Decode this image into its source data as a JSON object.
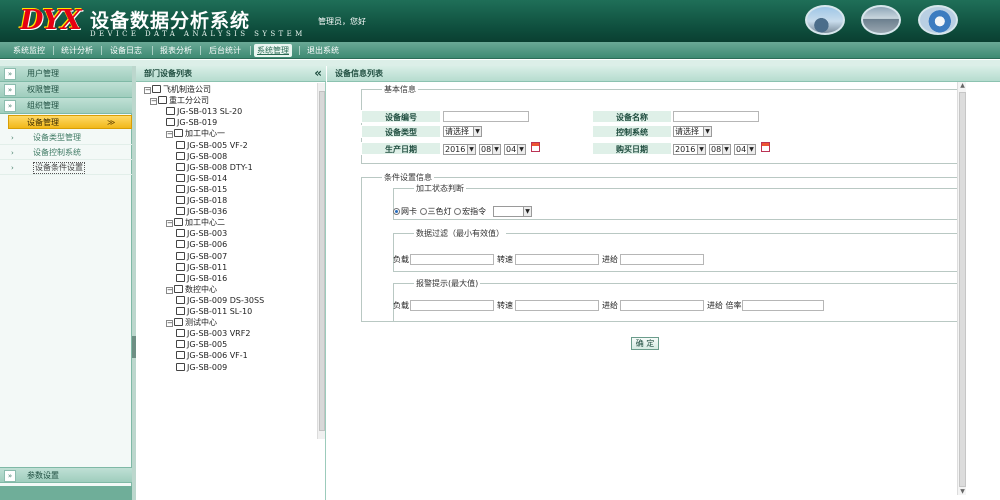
{
  "header": {
    "logo": "DYX",
    "title": "设备数据分析系统",
    "subtitle": "DEVICE DATA ANALYSIS SYSTEM",
    "greeting": "管理员，您好"
  },
  "nav": [
    "系统监控",
    "统计分析",
    "设备日志",
    "报表分析",
    "后台统计",
    "系统管理",
    "退出系统"
  ],
  "nav_active": "系统管理",
  "sidebar": {
    "arrows": "»",
    "sections": [
      "用户管理",
      "权限管理",
      "组织管理"
    ],
    "active_section": "设备管理",
    "active_chevron": "≫",
    "sub_items": [
      "设备类型管理",
      "设备控制系统",
      "设备条件设置"
    ],
    "settings": "参数设置"
  },
  "tree": {
    "title": "部门设备列表",
    "collapse": "«",
    "nodes": [
      {
        "label": "飞机制造公司",
        "level": 0
      },
      {
        "label": "重工分公司",
        "level": 1
      },
      {
        "label": "JG-SB-013 SL-20",
        "level": 2
      },
      {
        "label": "JG-SB-019",
        "level": 2
      },
      {
        "label": "加工中心一",
        "level": 2,
        "group": true
      },
      {
        "label": "JG-SB-005 VF-2",
        "level": 3
      },
      {
        "label": "JG-SB-008",
        "level": 3
      },
      {
        "label": "JG-SB-008 DTY-1",
        "level": 3
      },
      {
        "label": "JG-SB-014",
        "level": 3
      },
      {
        "label": "JG-SB-015",
        "level": 3
      },
      {
        "label": "JG-SB-018",
        "level": 3
      },
      {
        "label": "JG-SB-036",
        "level": 3
      },
      {
        "label": "加工中心二",
        "level": 2,
        "group": true
      },
      {
        "label": "JG-SB-003",
        "level": 3
      },
      {
        "label": "JG-SB-006",
        "level": 3
      },
      {
        "label": "JG-SB-007",
        "level": 3
      },
      {
        "label": "JG-SB-011",
        "level": 3
      },
      {
        "label": "JG-SB-016",
        "level": 3
      },
      {
        "label": "数控中心",
        "level": 2,
        "group": true
      },
      {
        "label": "JG-SB-009 DS-30SS",
        "level": 3
      },
      {
        "label": "JG-SB-011 SL-10",
        "level": 3
      },
      {
        "label": "测试中心",
        "level": 2,
        "group": true
      },
      {
        "label": "JG-SB-003 VRF2",
        "level": 3
      },
      {
        "label": "JG-SB-005",
        "level": 3
      },
      {
        "label": "JG-SB-006 VF-1",
        "level": 3
      },
      {
        "label": "JG-SB-009",
        "level": 3
      }
    ]
  },
  "main": {
    "title": "设备信息列表",
    "basic": {
      "legend": "基本信息",
      "device_code": "设备编号",
      "device_name": "设备名称",
      "device_type": "设备类型",
      "control_system": "控制系统",
      "placeholder_select": "请选择",
      "production_date": "生产日期",
      "purchase_date": "购买日期",
      "date_year": "2016",
      "date_month": "08",
      "date_day": "04"
    },
    "conditions": {
      "legend": "条件设置信息",
      "status_legend": "加工状态判断",
      "radios": [
        "网卡",
        "三色灯",
        "宏指令"
      ],
      "filter_legend": "数据过滤（最小有效值）",
      "alarm_legend": "报警提示(最大值)",
      "load": "负载",
      "speed": "转速",
      "feed": "进给",
      "feed_rate": "进给 倍率"
    },
    "confirm": "确 定"
  },
  "icons": {
    "collapse": "chevron-double-left-icon",
    "calendar": "calendar-icon"
  },
  "colors": {
    "header": "#0e4d3c",
    "accent": "#f1b81a",
    "label_bg": "#dff0e8"
  }
}
